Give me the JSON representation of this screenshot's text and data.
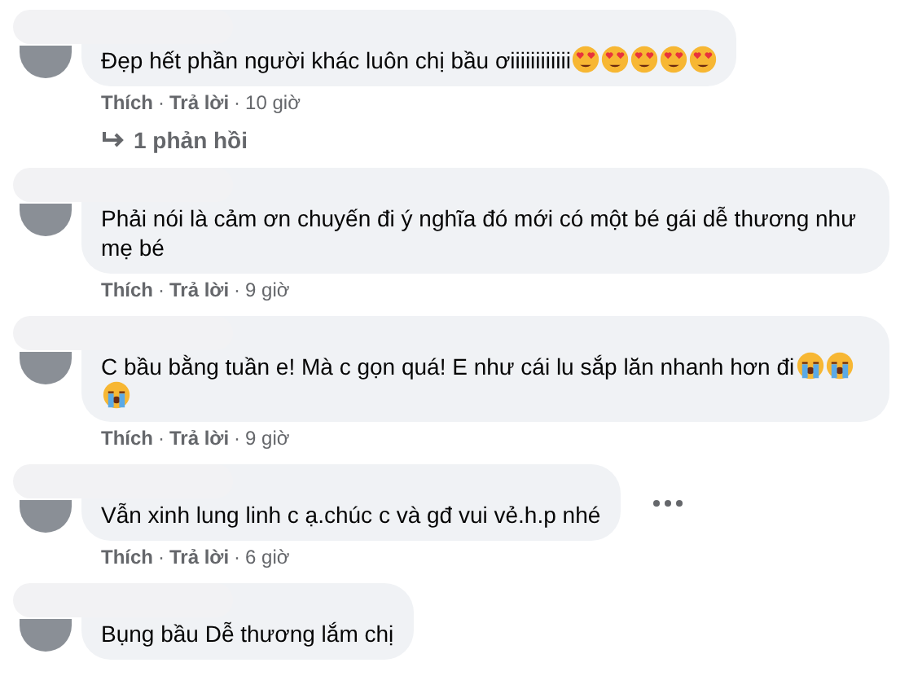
{
  "comments": [
    {
      "text": "Đẹp hết phần người khác luôn chị bầu ơiiiiiiiiiiii",
      "reactions": [
        {
          "kind": "heart_eyes"
        },
        {
          "kind": "heart_eyes"
        },
        {
          "kind": "heart_eyes"
        },
        {
          "kind": "heart_eyes"
        },
        {
          "kind": "heart_eyes"
        }
      ],
      "meta": [
        {
          "kind": "link",
          "text": "Thích"
        },
        {
          "kind": "separator",
          "text": "·"
        },
        {
          "kind": "link",
          "text": "Trả lời"
        },
        {
          "kind": "separator",
          "text": "·"
        },
        {
          "kind": "time",
          "text": "10 giờ"
        }
      ],
      "replies": "1 phản hồi",
      "menu": false
    },
    {
      "text": "Phải nói là cảm ơn chuyến đi ý nghĩa đó mới có một bé gái dễ thương như mẹ bé",
      "meta": [
        {
          "kind": "link",
          "text": "Thích"
        },
        {
          "kind": "separator",
          "text": "·"
        },
        {
          "kind": "link",
          "text": "Trả lời"
        },
        {
          "kind": "separator",
          "text": "·"
        },
        {
          "kind": "time",
          "text": "9 giờ"
        }
      ],
      "menu": false
    },
    {
      "text": "C bầu bằng tuần e! Mà c gọn quá! E như cái lu sắp lăn nhanh hơn đi",
      "reactions": [
        {
          "kind": "crying"
        },
        {
          "kind": "crying"
        },
        {
          "kind": "crying"
        }
      ],
      "meta": [
        {
          "kind": "link",
          "text": "Thích"
        },
        {
          "kind": "separator",
          "text": "·"
        },
        {
          "kind": "link",
          "text": "Trả lời"
        },
        {
          "kind": "separator",
          "text": "·"
        },
        {
          "kind": "time",
          "text": "9 giờ"
        }
      ],
      "menu": false
    },
    {
      "text": "Vẫn xinh lung linh c ạ.chúc c và gđ vui vẻ.h.p nhé",
      "meta": [
        {
          "kind": "link",
          "text": "Thích"
        },
        {
          "kind": "separator",
          "text": "·"
        },
        {
          "kind": "link",
          "text": "Trả lời"
        },
        {
          "kind": "separator",
          "text": "·"
        },
        {
          "kind": "time",
          "text": "6 giờ"
        }
      ],
      "menu": true
    },
    {
      "text": "Bụng bầu Dễ thương lắm chị",
      "menu": false
    }
  ]
}
